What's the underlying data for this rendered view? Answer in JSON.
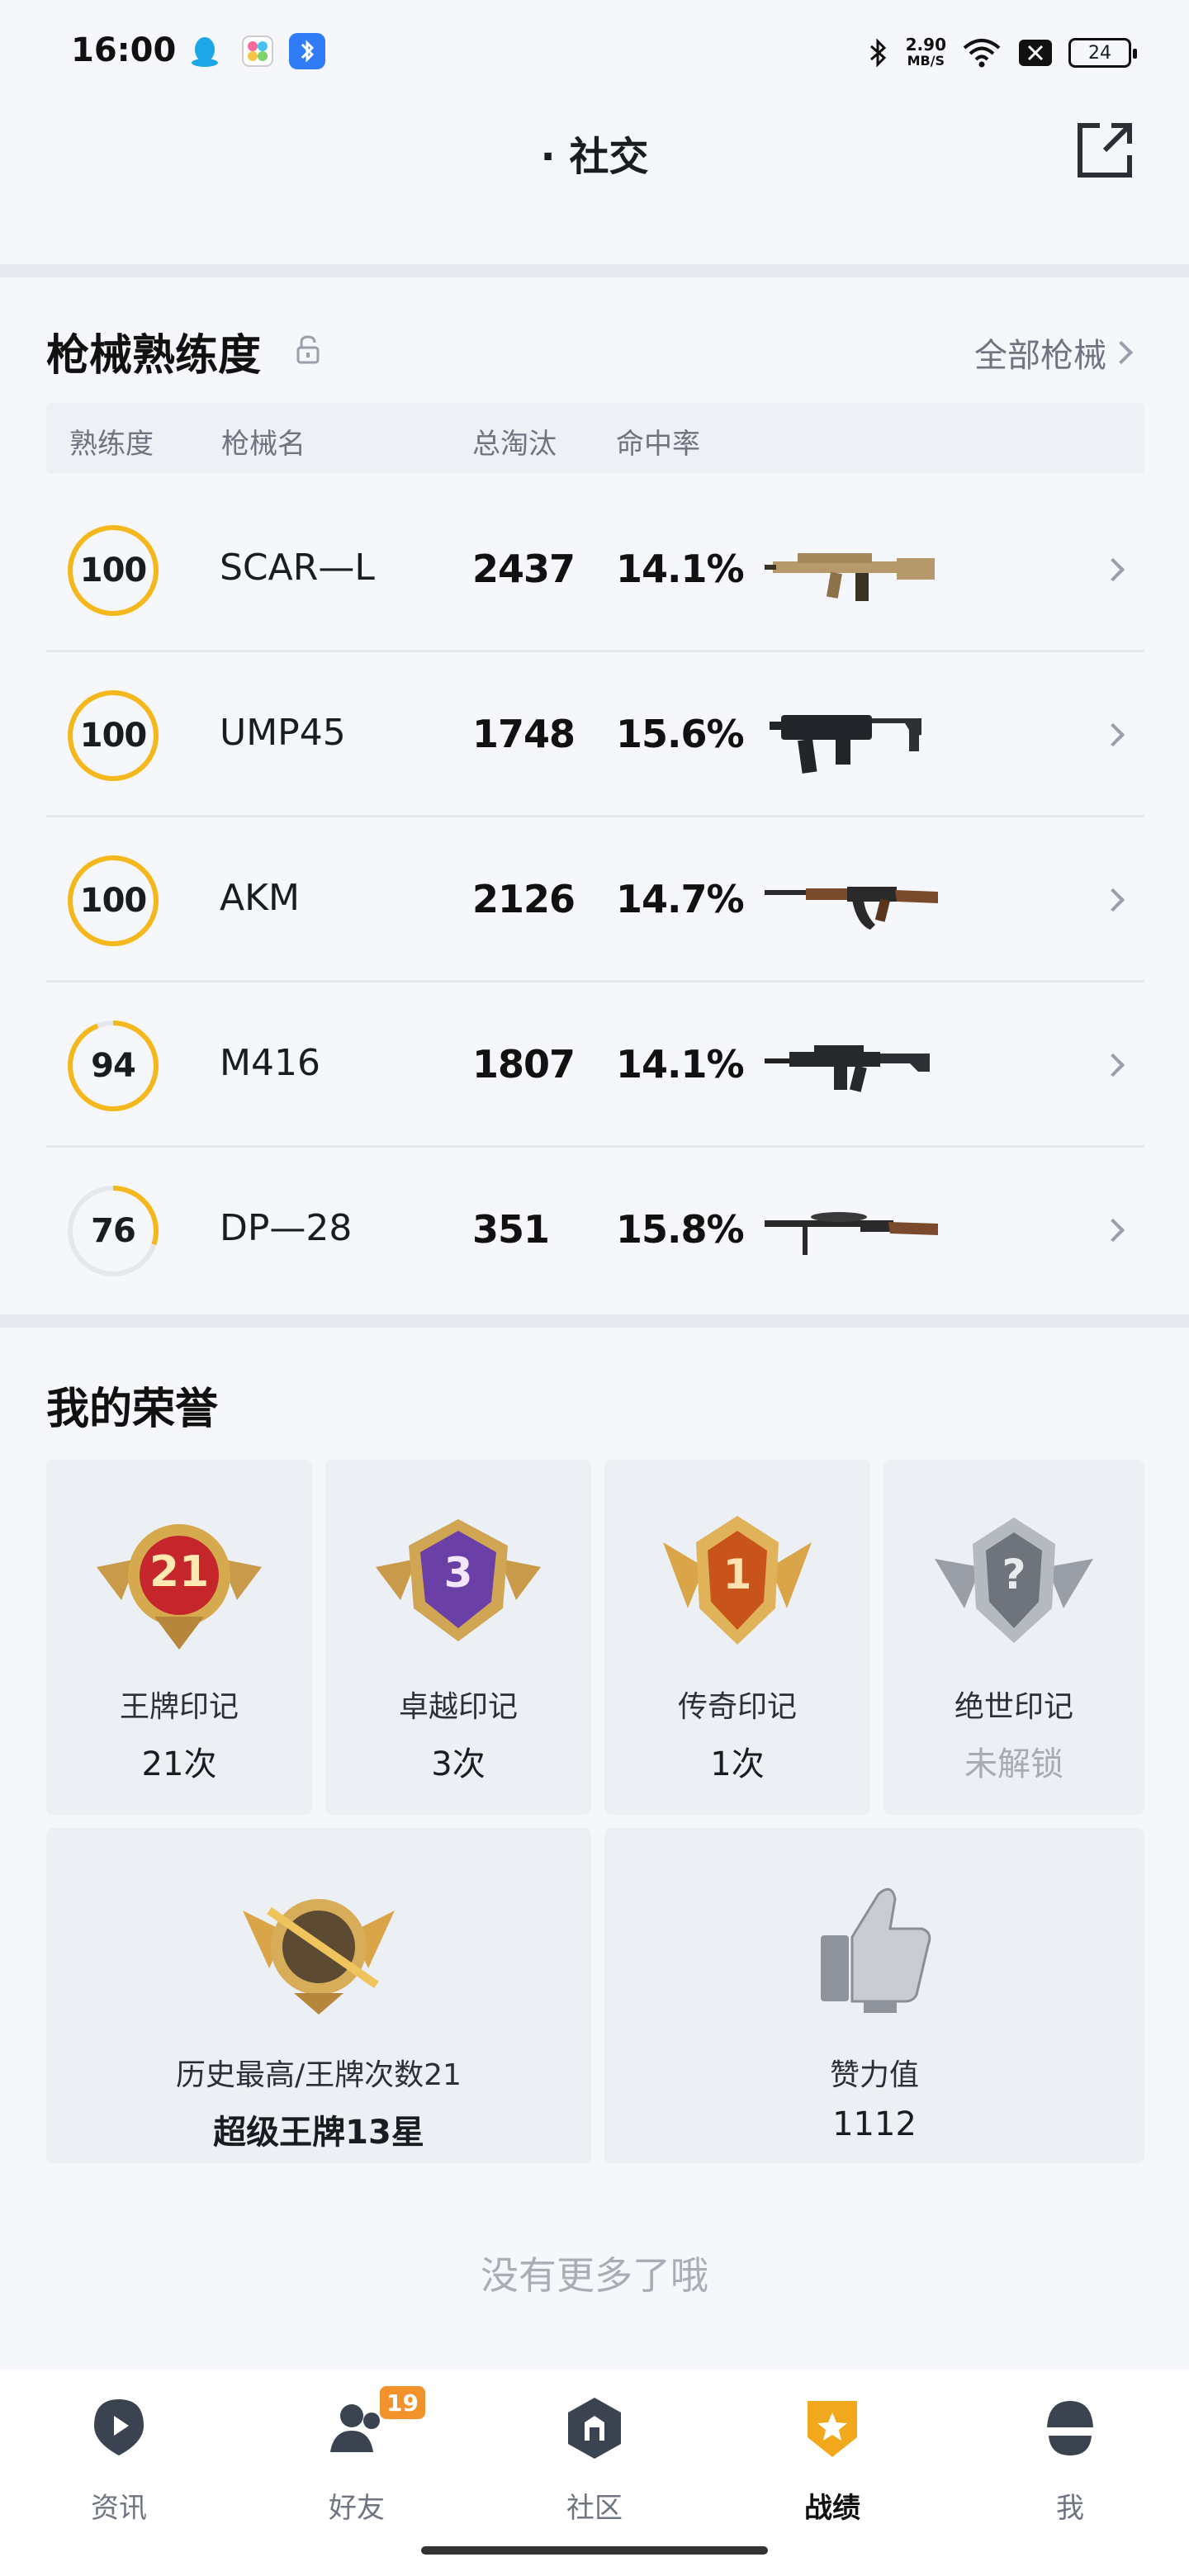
{
  "status_bar": {
    "time": "16:00",
    "net_speed_value": "2.90",
    "net_speed_unit": "MB/S",
    "battery": "24"
  },
  "header": {
    "title": "· 社交"
  },
  "weapons": {
    "title": "枪械熟练度",
    "all_link": "全部枪械",
    "columns": [
      "熟练度",
      "枪械名",
      "总淘汰",
      "命中率"
    ],
    "ring_color": "#f5b81c",
    "rows": [
      {
        "proficiency": "100",
        "progress": 1.0,
        "name": "SCAR—L",
        "kills": "2437",
        "hit_rate": "14.1%"
      },
      {
        "proficiency": "100",
        "progress": 1.0,
        "name": "UMP45",
        "kills": "1748",
        "hit_rate": "15.6%"
      },
      {
        "proficiency": "100",
        "progress": 1.0,
        "name": "AKM",
        "kills": "2126",
        "hit_rate": "14.7%"
      },
      {
        "proficiency": "94",
        "progress": 0.94,
        "name": "M416",
        "kills": "1807",
        "hit_rate": "14.1%"
      },
      {
        "proficiency": "76",
        "progress": 0.3,
        "name": "DP—28",
        "kills": "351",
        "hit_rate": "15.8%"
      }
    ]
  },
  "honors": {
    "title": "我的荣誉",
    "cards": [
      {
        "badge_text": "21",
        "label": "王牌印记",
        "value": "21次",
        "locked": false
      },
      {
        "badge_text": "3",
        "label": "卓越印记",
        "value": "3次",
        "locked": false
      },
      {
        "badge_text": "1",
        "label": "传奇印记",
        "value": "1次",
        "locked": false
      },
      {
        "badge_text": "?",
        "label": "绝世印记",
        "value": "未解锁",
        "locked": true
      }
    ],
    "wide_cards": [
      {
        "label": "历史最高/王牌次数21",
        "value": "超级王牌13星"
      },
      {
        "label": "赞力值",
        "value": "1112"
      }
    ]
  },
  "no_more": "没有更多了哦",
  "bottom_nav": {
    "items": [
      {
        "label": "资讯",
        "icon": "news-icon",
        "badge": ""
      },
      {
        "label": "好友",
        "icon": "friends-icon",
        "badge": "19"
      },
      {
        "label": "社区",
        "icon": "community-icon",
        "badge": ""
      },
      {
        "label": "战绩",
        "icon": "record-icon",
        "badge": ""
      },
      {
        "label": "我",
        "icon": "profile-icon",
        "badge": ""
      }
    ],
    "active_index": 3
  }
}
